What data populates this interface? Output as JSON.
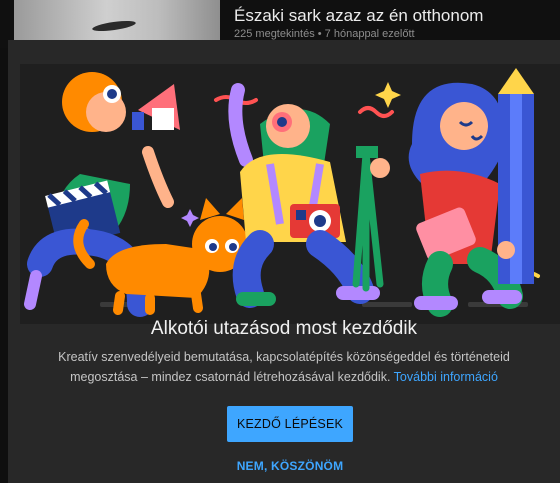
{
  "background_video": {
    "title": "Északi sark azaz az én otthonom",
    "meta": "225 megtekintés • 7 hónappal ezelőtt"
  },
  "dialog": {
    "title": "Alkotói utazásod most kezdődik",
    "description": "Kreatív szenvedélyeid bemutatása, kapcsolatépítés közönségeddel és történeteid megosztása – mindez csatornád létrehozásával kezdődik.",
    "learn_more": "További információ",
    "primary_button": "KEZDŐ LÉPÉSEK",
    "secondary_button": "NEM, KÖSZÖNÖM"
  },
  "colors": {
    "dialog_bg": "#282828",
    "accent": "#3ea6ff",
    "illustration_bg": "#1f1f1f"
  }
}
